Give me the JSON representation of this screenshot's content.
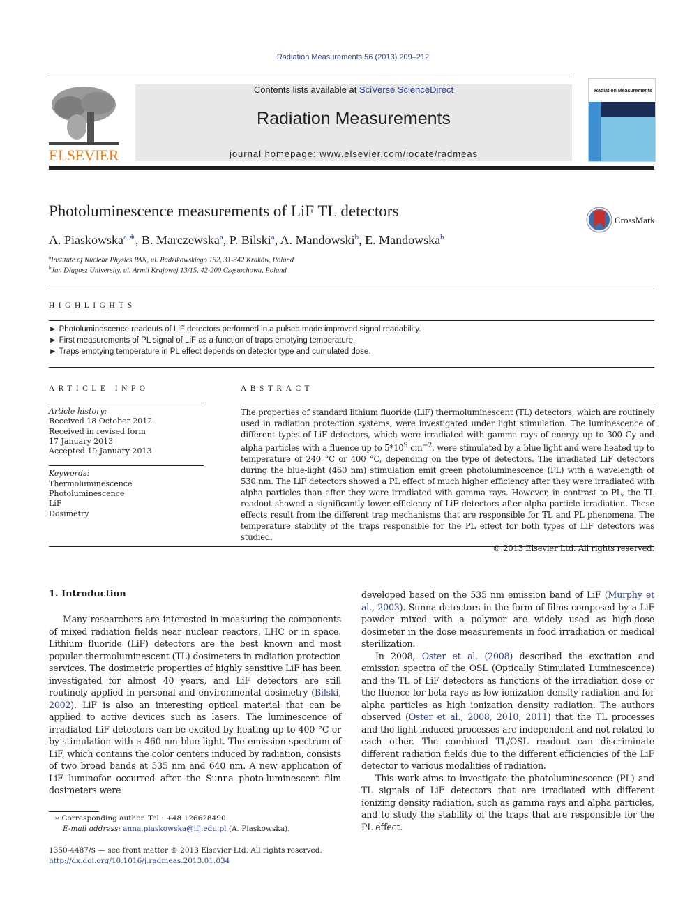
{
  "header": {
    "citation": "Radiation Measurements 56 (2013) 209–212",
    "contents_prefix": "Contents lists available at ",
    "contents_link": "SciVerse ScienceDirect",
    "journal_name": "Radiation Measurements",
    "homepage_prefix": "journal homepage: ",
    "homepage_url": "www.elsevier.com/locate/radmeas",
    "publisher_logo_text": "ELSEVIER",
    "cover_title": "Radiation Measurements",
    "crossmark_label": "CrossMark"
  },
  "colors": {
    "link": "#2a3f96",
    "elsevier_orange": "#f07f1a",
    "band_gray": "#e8e8e8",
    "cover_blue": "#7ec4e4",
    "crossmark_red": "#c9302c"
  },
  "article": {
    "title": "Photoluminescence measurements of LiF TL detectors",
    "authors": [
      {
        "name": "A. Piaskowska",
        "sup": "a,∗",
        "sep": ", "
      },
      {
        "name": "B. Marczewska",
        "sup": "a",
        "sep": ", "
      },
      {
        "name": "P. Bilski",
        "sup": "a",
        "sep": ", "
      },
      {
        "name": "A. Mandowski",
        "sup": "b",
        "sep": ", "
      },
      {
        "name": "E. Mandowska",
        "sup": "b",
        "sep": ""
      }
    ],
    "affiliations": [
      {
        "mark": "a",
        "text": "Institute of Nuclear Physics PAN, ul. Radzikowskiego 152, 31-342 Kraków, Poland"
      },
      {
        "mark": "b",
        "text": "Jan Długosz University, ul. Armii Krajowej 13/15, 42-200 Częstochowa, Poland"
      }
    ]
  },
  "highlights": {
    "heading": "HIGHLIGHTS",
    "bullet": "►",
    "items": [
      "Photoluminescence readouts of LiF detectors performed in a pulsed mode improved signal readability.",
      "First measurements of PL signal of LiF as a function of traps emptying temperature.",
      "Traps emptying temperature in PL effect depends on detector type and cumulated dose."
    ]
  },
  "article_info": {
    "heading": "ARTICLE INFO",
    "history_label": "Article history:",
    "history": [
      "Received 18 October 2012",
      "Received in revised form",
      "17 January 2013",
      "Accepted 19 January 2013"
    ],
    "keywords_label": "Keywords:",
    "keywords": [
      "Thermoluminescence",
      "Photoluminescence",
      "LiF",
      "Dosimetry"
    ]
  },
  "abstract": {
    "heading": "ABSTRACT",
    "text_part1": "The properties of standard lithium fluoride (LiF) thermoluminescent (TL) detectors, which are routinely used in radiation protection systems, were investigated under light stimulation. The luminescence of different types of LiF detectors, which were irradiated with gamma rays of energy up to 300 Gy and alpha particles with a fluence up to 5*10",
    "sup1": "9",
    "text_part2": " cm",
    "sup2": "−2",
    "text_part3": ", were stimulated by a blue light and were heated up to temperature of 240 °C or 400 °C, depending on the type of detectors. The irradiated LiF detectors during the blue-light (460 nm) stimulation emit green photoluminescence (PL) with a wavelength of 530 nm. The LiF detectors showed a PL effect of much higher efficiency after they were irradiated with alpha particles than after they were irradiated with gamma rays. However, in contrast to PL, the TL readout showed a significantly lower efficiency of LiF detectors after alpha particle irradiation. These effects result from the different trap mechanisms that are responsible for TL and PL phenomena. The temperature stability of the traps responsible for the PL effect for both types of LiF detectors was studied.",
    "copyright": "© 2013 Elsevier Ltd. All rights reserved."
  },
  "body": {
    "section_heading": "1.  Introduction",
    "left_p1_a": "Many researchers are interested in measuring the components of mixed radiation fields near nuclear reactors, LHC or in space. Lithium fluoride (LiF) detectors are the best known and most popular thermoluminescent (TL) dosimeters in radiation protection services. The dosimetric properties of highly sensitive LiF has been investigated for almost 40 years, and LiF detectors are still routinely applied in personal and environmental dosimetry (",
    "left_p1_ref": "Bilski, 2002",
    "left_p1_b": "). LiF is also an interesting optical material that can be applied to active devices such as lasers. The luminescence of irradiated LiF detectors can be excited by heating up to 400 °C or by stimulation with a 460 nm blue light. The emission spectrum of LiF, which contains the color centers induced by radiation, consists of two broad bands at 535 nm and 640 nm. A new application of LiF luminofor occurred after the Sunna photo-luminescent film dosimeters were",
    "right_p1_a": "developed based on the 535 nm emission band of LiF (",
    "right_p1_ref": "Murphy et al., 2003",
    "right_p1_b": "). Sunna detectors in the form of films composed by a LiF powder mixed with a polymer are widely used as high-dose dosimeter in the dose measurements in food irradiation or medical sterilization.",
    "right_p2_a": "In 2008, ",
    "right_p2_ref1": "Oster et al. (2008)",
    "right_p2_b": " described the excitation and emission spectra of the OSL (Optically Stimulated Luminescence) and the TL of LiF detectors as functions of the irradiation dose or the fluence for beta rays as low ionization density radiation and for alpha particles as high ionization density radiation. The authors observed (",
    "right_p2_ref2": "Oster et al., 2008, 2010, 2011",
    "right_p2_c": ") that the TL processes and the light-induced processes are independent and not related to each other. The combined TL/OSL readout can discriminate different radiation fields due to the different efficiencies of the LiF detector to various modalities of radiation.",
    "right_p3": "This work aims to investigate the photoluminescence (PL) and TL signals of LiF detectors that are irradiated with different ionizing density radiation, such as gamma rays and alpha particles, and to study the stability of the traps that are responsible for the PL effect."
  },
  "footnote": {
    "mark": "∗",
    "corresponding": "Corresponding author. Tel.: +48 126628490.",
    "email_label": "E-mail address: ",
    "email": "anna.piaskowska@ifj.edu.pl",
    "email_suffix": " (A. Piaskowska)."
  },
  "front_matter": {
    "issn_line": "1350-4487/$ — see front matter © 2013 Elsevier Ltd. All rights reserved.",
    "doi": "http://dx.doi.org/10.1016/j.radmeas.2013.01.034"
  }
}
